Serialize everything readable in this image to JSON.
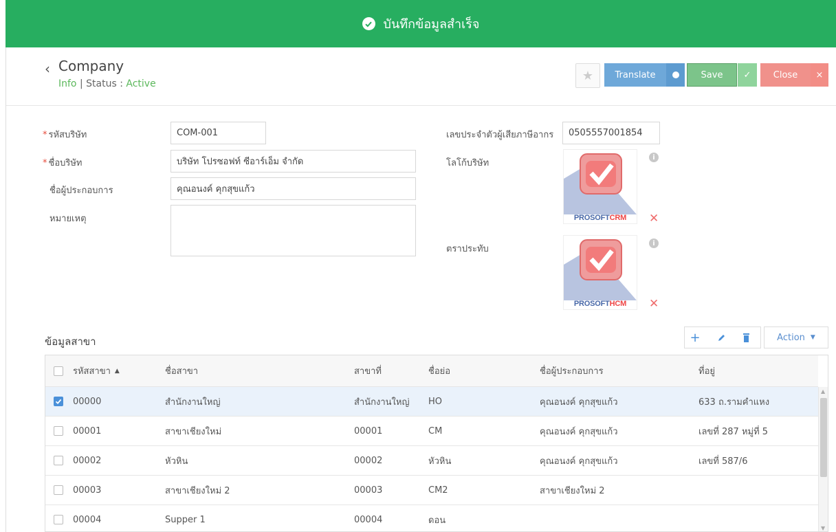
{
  "toast": {
    "message": "บันทึกข้อมูลสำเร็จ",
    "color": "#27ae60"
  },
  "header": {
    "back_icon": "chevron-left-icon",
    "title": "Company",
    "crumb_info": "Info",
    "crumb_sep": "|",
    "status_label": "Status",
    "status_colon": ":",
    "status_value": "Active"
  },
  "toolbar": {
    "translate_label": "Translate",
    "save_label": "Save",
    "close_label": "Close"
  },
  "form": {
    "company_code_label": "รหัสบริษัท",
    "company_code_value": "COM-001",
    "company_name_label": "ชื่อบริษัท",
    "company_name_value": "บริษัท โปรซอฟท์ ซีอาร์เอ็ม จำกัด",
    "operator_label": "ชื่อผู้ประกอบการ",
    "operator_value": "คุณอนงค์ คุกสุขแก้ว",
    "note_label": "หมายเหตุ",
    "note_value": "",
    "tax_id_label": "เลขประจำตัวผู้เสียภาษีอากร",
    "tax_id_value": "0505557001854",
    "logo_label": "โลโก้บริษัท",
    "logo_brand_a": "PROSOFT",
    "logo_brand_b": "CRM",
    "stamp_label": "ตราประทับ",
    "stamp_brand_a": "PROSOFT",
    "stamp_brand_b": "HCM"
  },
  "branches": {
    "section_title": "ข้อมูลสาขา",
    "action_label": "Action",
    "columns": [
      "รหัสสาขา",
      "ชื่อสาขา",
      "สาขาที่",
      "ชื่อย่อ",
      "ชื่อผู้ประกอบการ",
      "ที่อยู่"
    ],
    "sort_indicator": "▲",
    "rows": [
      {
        "selected": true,
        "code": "00000",
        "name": "สำนักงานใหญ่",
        "branch_no": "สำนักงานใหญ่",
        "abbr": "HO",
        "operator": "คุณอนงค์ คุกสุขแก้ว",
        "address": "633 ถ.รามคำแหง"
      },
      {
        "selected": false,
        "code": "00001",
        "name": "สาขาเชียงใหม่",
        "branch_no": "00001",
        "abbr": "CM",
        "operator": "คุณอนงค์ คุกสุขแก้ว",
        "address": "เลขที่ 287 หมู่ที่ 5"
      },
      {
        "selected": false,
        "code": "00002",
        "name": "หัวหิน",
        "branch_no": "00002",
        "abbr": "หัวหิน",
        "operator": "คุณอนงค์ คุกสุขแก้ว",
        "address": "เลขที่ 587/6"
      },
      {
        "selected": false,
        "code": "00003",
        "name": "สาขาเชียงใหม่ 2",
        "branch_no": "00003",
        "abbr": "CM2",
        "operator": "สาขาเชียงใหม่ 2",
        "address": ""
      },
      {
        "selected": false,
        "code": "00004",
        "name": "Supper 1",
        "branch_no": "00004",
        "abbr": "ดอน",
        "operator": "",
        "address": ""
      }
    ]
  }
}
